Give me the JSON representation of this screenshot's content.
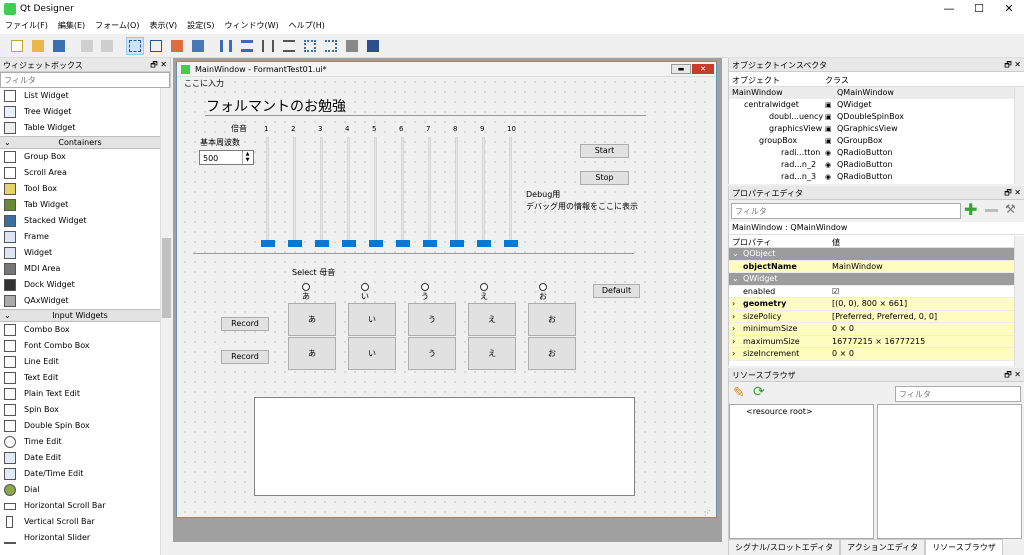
{
  "window": {
    "title": "Qt Designer",
    "minimize": "—",
    "maximize": "☐",
    "close": "✕"
  },
  "menubar": [
    "ファイル(F)",
    "編集(E)",
    "フォーム(O)",
    "表示(V)",
    "設定(S)",
    "ウィンドウ(W)",
    "ヘルプ(H)"
  ],
  "widget_box": {
    "title": "ウィジェットボックス",
    "filter_placeholder": "フィルタ",
    "items_top": [
      "List Widget",
      "Tree Widget",
      "Table Widget"
    ],
    "cat_containers": "Containers",
    "containers": [
      "Group Box",
      "Scroll Area",
      "Tool Box",
      "Tab Widget",
      "Stacked Widget",
      "Frame",
      "Widget",
      "MDI Area",
      "Dock Widget",
      "QAxWidget"
    ],
    "cat_input": "Input Widgets",
    "inputs": [
      "Combo Box",
      "Font Combo Box",
      "Line Edit",
      "Text Edit",
      "Plain Text Edit",
      "Spin Box",
      "Double Spin Box",
      "Time Edit",
      "Date Edit",
      "Date/Time Edit",
      "Dial",
      "Horizontal Scroll Bar",
      "Vertical Scroll Bar",
      "Horizontal Slider"
    ]
  },
  "subwindow": {
    "title": "MainWindow - FormantTest01.ui*",
    "menu_placeholder": "ここに入力",
    "heading": "フォルマントのお勉強",
    "overtone_label": "倍音",
    "overtone_numbers": [
      "1",
      "2",
      "3",
      "4",
      "5",
      "6",
      "7",
      "8",
      "9",
      "10"
    ],
    "base_freq_label": "基本周波数",
    "base_freq_value": "500",
    "start": "Start",
    "stop": "Stop",
    "debug_title": "Debug用",
    "debug_text": "デバッグ用の情報をここに表示",
    "select_label": "Select 母音",
    "vowels": [
      "あ",
      "い",
      "う",
      "え",
      "お"
    ],
    "default": "Default",
    "record1": "Record",
    "record2": "Record"
  },
  "object_inspector": {
    "title": "オブジェクトインスペクタ",
    "col_object": "オブジェクト",
    "col_class": "クラス",
    "rows": [
      {
        "obj": "MainWindow",
        "cls": "QMainWindow"
      },
      {
        "obj": "centralwidget",
        "cls": "QWidget"
      },
      {
        "obj": "doubl...uency",
        "cls": "QDoubleSpinBox"
      },
      {
        "obj": "graphicsView",
        "cls": "QGraphicsView"
      },
      {
        "obj": "groupBox",
        "cls": "QGroupBox"
      },
      {
        "obj": "radi...tton",
        "cls": "QRadioButton"
      },
      {
        "obj": "rad...n_2",
        "cls": "QRadioButton"
      },
      {
        "obj": "rad...n_3",
        "cls": "QRadioButton"
      }
    ]
  },
  "property_editor": {
    "title": "プロパティエディタ",
    "filter_placeholder": "フィルタ",
    "context": "MainWindow : QMainWindow",
    "col_prop": "プロパティ",
    "col_value": "値",
    "rows": [
      {
        "p": "QObject",
        "v": "",
        "kind": "sec"
      },
      {
        "p": "objectName",
        "v": "MainWindow",
        "kind": "yel-bold"
      },
      {
        "p": "QWidget",
        "v": "",
        "kind": "sec"
      },
      {
        "p": "enabled",
        "v": "☑",
        "kind": "plain"
      },
      {
        "p": "geometry",
        "v": "[(0, 0), 800 × 661]",
        "kind": "yel-bold"
      },
      {
        "p": "sizePolicy",
        "v": "[Preferred, Preferred, 0, 0]",
        "kind": "yel"
      },
      {
        "p": "minimumSize",
        "v": "0 × 0",
        "kind": "yel"
      },
      {
        "p": "maximumSize",
        "v": "16777215 × 16777215",
        "kind": "yel"
      },
      {
        "p": "sizeIncrement",
        "v": "0 × 0",
        "kind": "yel"
      }
    ]
  },
  "resource_browser": {
    "title": "リソースブラウザ",
    "filter_placeholder": "フィルタ",
    "root": "<resource root>"
  },
  "bottom_tabs": [
    "シグナル/スロットエディタ",
    "アクションエディタ",
    "リソースブラウザ"
  ]
}
